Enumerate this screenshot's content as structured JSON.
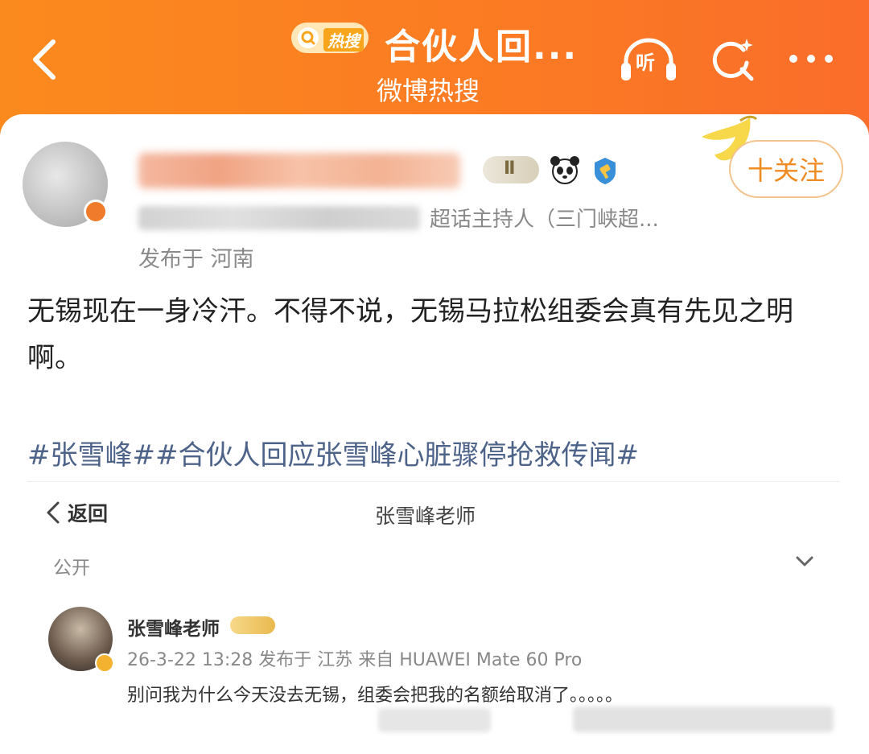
{
  "header": {
    "badge_label": "热搜",
    "title": "合伙人回...",
    "subtitle": "微博热搜",
    "listen_label": "听",
    "more_label": "···",
    "colors": {
      "header_bg": "#fb7f24",
      "badge_bg": "#ffe7b8",
      "badge_accent": "#f9a51b"
    }
  },
  "post": {
    "level_badge": "Ⅱ",
    "follow_label": "十关注",
    "host_role": "超话主持人（三门峡超...",
    "location": "发布于 河南",
    "body": "无锡现在一身冷汗。不得不说，无锡马拉松组委会真有先见之明啊。",
    "hashtags": "#张雪峰##合伙人回应张雪峰心脏骤停抢救传闻#",
    "colors": {
      "follow_text": "#f08a22",
      "hashtag": "#4e6389"
    }
  },
  "embedded": {
    "back_label": "返回",
    "title": "张雪峰老师",
    "visibility": "公开",
    "author_name": "张雪峰老师",
    "meta": "26-3-22 13:28 发布于 江苏 来自 HUAWEI Mate 60 Pro",
    "text": "别问我为什么今天没去无锡，组委会把我的名额给取消了。。。。。"
  }
}
